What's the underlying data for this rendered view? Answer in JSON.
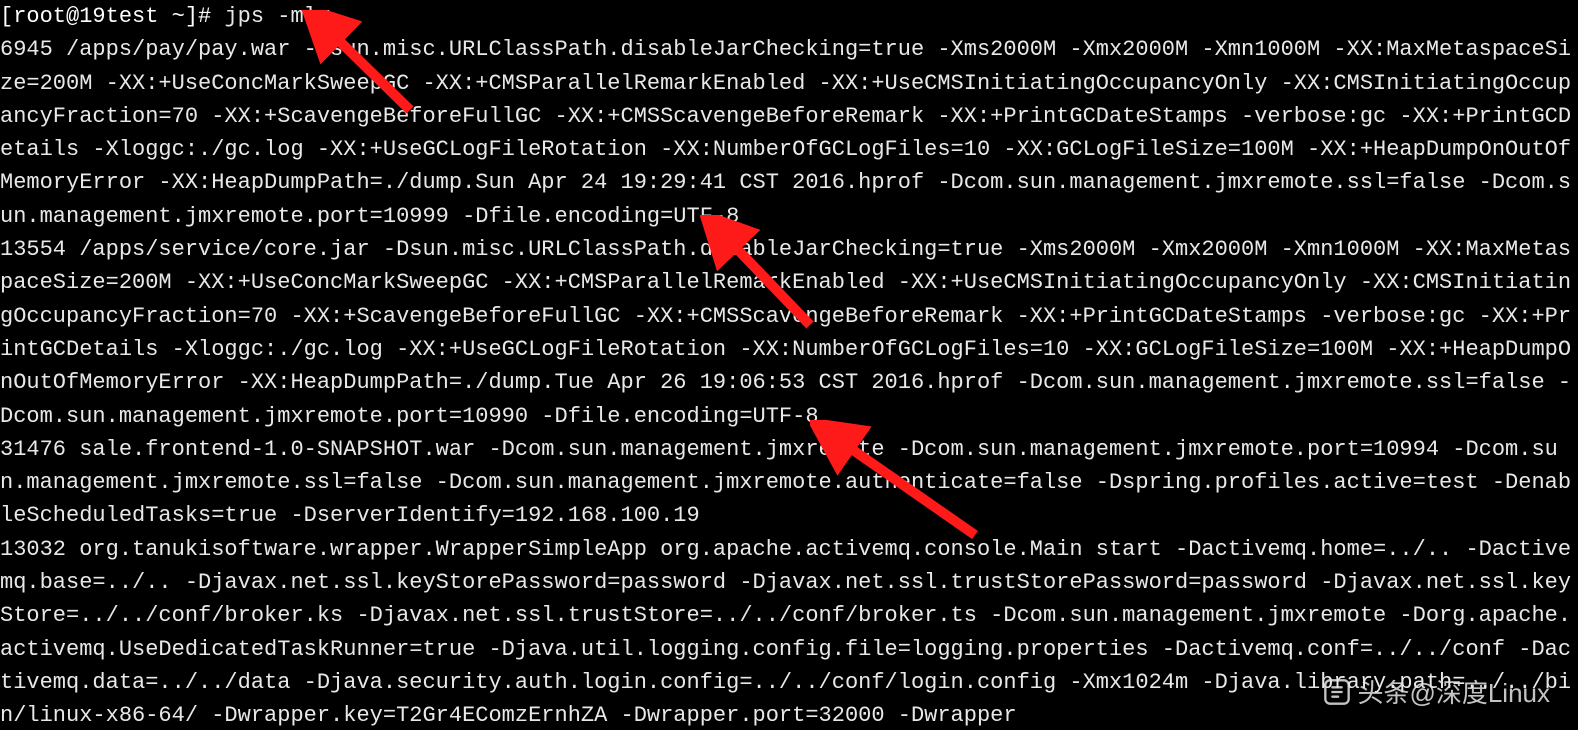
{
  "terminal": {
    "prompt": "[root@19test ~]# ",
    "command": "jps -mlv",
    "output": "6945 /apps/pay/pay.war -Dsun.misc.URLClassPath.disableJarChecking=true -Xms2000M -Xmx2000M -Xmn1000M -XX:MaxMetaspaceSize=200M -XX:+UseConcMarkSweepGC -XX:+CMSParallelRemarkEnabled -XX:+UseCMSInitiatingOccupancyOnly -XX:CMSInitiatingOccupancyFraction=70 -XX:+ScavengeBeforeFullGC -XX:+CMSScavengeBeforeRemark -XX:+PrintGCDateStamps -verbose:gc -XX:+PrintGCDetails -Xloggc:./gc.log -XX:+UseGCLogFileRotation -XX:NumberOfGCLogFiles=10 -XX:GCLogFileSize=100M -XX:+HeapDumpOnOutOfMemoryError -XX:HeapDumpPath=./dump.Sun Apr 24 19:29:41 CST 2016.hprof -Dcom.sun.management.jmxremote.ssl=false -Dcom.sun.management.jmxremote.port=10999 -Dfile.encoding=UTF-8\n13554 /apps/service/core.jar -Dsun.misc.URLClassPath.disableJarChecking=true -Xms2000M -Xmx2000M -Xmn1000M -XX:MaxMetaspaceSize=200M -XX:+UseConcMarkSweepGC -XX:+CMSParallelRemarkEnabled -XX:+UseCMSInitiatingOccupancyOnly -XX:CMSInitiatingOccupancyFraction=70 -XX:+ScavengeBeforeFullGC -XX:+CMSScavengeBeforeRemark -XX:+PrintGCDateStamps -verbose:gc -XX:+PrintGCDetails -Xloggc:./gc.log -XX:+UseGCLogFileRotation -XX:NumberOfGCLogFiles=10 -XX:GCLogFileSize=100M -XX:+HeapDumpOnOutOfMemoryError -XX:HeapDumpPath=./dump.Tue Apr 26 19:06:53 CST 2016.hprof -Dcom.sun.management.jmxremote.ssl=false -Dcom.sun.management.jmxremote.port=10990 -Dfile.encoding=UTF-8\n31476 sale.frontend-1.0-SNAPSHOT.war -Dcom.sun.management.jmxremote -Dcom.sun.management.jmxremote.port=10994 -Dcom.sun.management.jmxremote.ssl=false -Dcom.sun.management.jmxremote.authenticate=false -Dspring.profiles.active=test -DenableScheduledTasks=true -DserverIdentify=192.168.100.19\n13032 org.tanukisoftware.wrapper.WrapperSimpleApp org.apache.activemq.console.Main start -Dactivemq.home=../.. -Dactivemq.base=../.. -Djavax.net.ssl.keyStorePassword=password -Djavax.net.ssl.trustStorePassword=password -Djavax.net.ssl.keyStore=../../conf/broker.ks -Djavax.net.ssl.trustStore=../../conf/broker.ts -Dcom.sun.management.jmxremote -Dorg.apache.activemq.UseDedicatedTaskRunner=true -Djava.util.logging.config.file=logging.properties -Dactivemq.conf=../../conf -Dactivemq.data=../../data -Djava.security.auth.login.config=../../conf/login.config -Xmx1024m -Djava.library.path=../../bin/linux-x86-64/ -Dwrapper.key=T2Gr4EComzErnhZA -Dwrapper.port=32000 -Dwrapper"
  },
  "watermark": {
    "text": "头条@深度Linux"
  }
}
